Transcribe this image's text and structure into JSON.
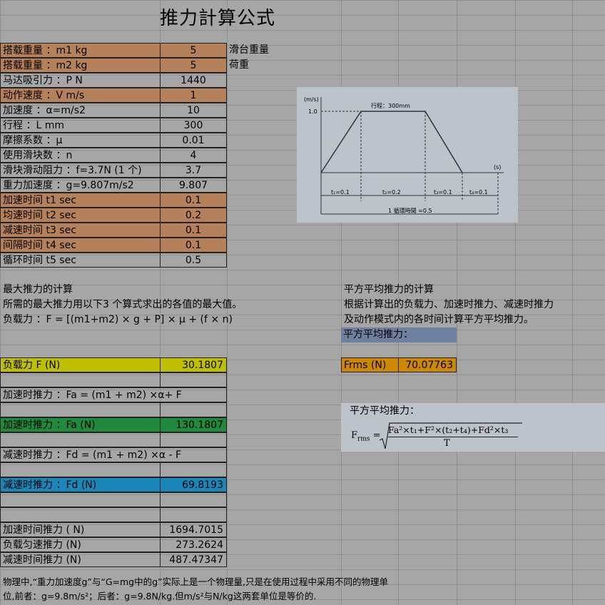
{
  "title": "推力計算公式",
  "params": [
    {
      "label": "搭载重量 ：m1   kg",
      "value": "5",
      "note": "滑台重量",
      "color": "orange"
    },
    {
      "label": "搭载重量 ：m2   kg",
      "value": "5",
      "note": "荷重",
      "color": "orange"
    },
    {
      "label": "马达吸引力 ：P   N",
      "value": "1440",
      "note": "",
      "color": ""
    },
    {
      "label": "动作速度 ：V  m/s",
      "value": "1",
      "note": "",
      "color": "orange"
    },
    {
      "label": "加速度 ：α=m/s2",
      "value": "10",
      "note": "",
      "color": ""
    },
    {
      "label": "行程 ：L mm",
      "value": "300",
      "note": "",
      "color": ""
    },
    {
      "label": "摩擦系数 ：μ",
      "value": "0.01",
      "note": "",
      "color": ""
    },
    {
      "label": "使用滑块数 ：n",
      "value": "4",
      "note": "",
      "color": ""
    },
    {
      "label": "滑块滑动阻力 ：f=3.7N (1 个)",
      "value": "3.7",
      "note": "",
      "color": ""
    },
    {
      "label": "重力加速度 ：g=9.807m/s2",
      "value": "9.807",
      "note": "",
      "color": ""
    },
    {
      "label": "加速时间 t1  sec",
      "value": "0.1",
      "note": "",
      "color": "orange"
    },
    {
      "label": "均速时间 t2 sec",
      "value": "0.2",
      "note": "",
      "color": "orange"
    },
    {
      "label": "减速时间 t3  sec",
      "value": "0.1",
      "note": "",
      "color": "orange"
    },
    {
      "label": "间隔时间 t4 sec",
      "value": "0.1",
      "note": "",
      "color": "orange"
    },
    {
      "label": "循环时间 t5 sec",
      "value": "0.5",
      "note": "",
      "color": ""
    }
  ],
  "max_thrust": {
    "heading": "最大推力的计算",
    "desc": "所需的最大推力用以下3 个算式求出的各值的最大值。",
    "formula": "负载力 ：F = [(m1+m2) × g + P] × μ + (f × n)",
    "load_label": "负载力 F (N)",
    "load_value": "30.1807",
    "accel_formula": "加速时推力 ：Fa = (m1 + m2) ×α+ F",
    "accel_label": "加速时推力 ：Fa (N)",
    "accel_value": "130.1807",
    "decel_formula": "减速时推力 ：Fd = (m1 + m2) ×α - F",
    "decel_label": "减速时推力 ：Fd (N)",
    "decel_value": "69.8193"
  },
  "results": [
    {
      "label": "加速时间推力 ( N)",
      "value": "1694.7015"
    },
    {
      "label": "负载匀速推力  (N)",
      "value": "273.2624"
    },
    {
      "label": "减速时间推力  (N)",
      "value": "487.47347"
    }
  ],
  "rms": {
    "heading": "平方平均推力的计算",
    "desc1": "根据计算出的负载力、加速时推力、减速时推力",
    "desc2": "及动作模式内的各时间计算平方平均推力。",
    "header": "平方平均推力：",
    "label": "Frms (N)",
    "value": "70.07763",
    "formula_title": "平方平均推力：",
    "formula_lhs": "F",
    "formula_lhs_sub": "rms",
    "formula_num": "Fa²×t₁+F²×(t₂+t₄)+Fd²×t₃",
    "formula_den": "T"
  },
  "diagram": {
    "y_unit": "(m/s)",
    "y_value": "1.0",
    "x_unit": "(s)",
    "stroke": "行程：300mm",
    "t1": "t₁=0.1",
    "t2": "t₂=0.2",
    "t3": "t₃=0.1",
    "t4": "t₄=0.1",
    "cycle": "1 循環時間 =0.5"
  },
  "footer": {
    "line1": "物理中,“重力加速度g”与“G=mg中的g”实际上是一个物理量,只是在使用过程中采用不同的物理单",
    "line2": "位,前者：g=9.8m/s²；后者：g=9.8N/kg.但m/s²与N/kg这两套单位是等价的."
  }
}
